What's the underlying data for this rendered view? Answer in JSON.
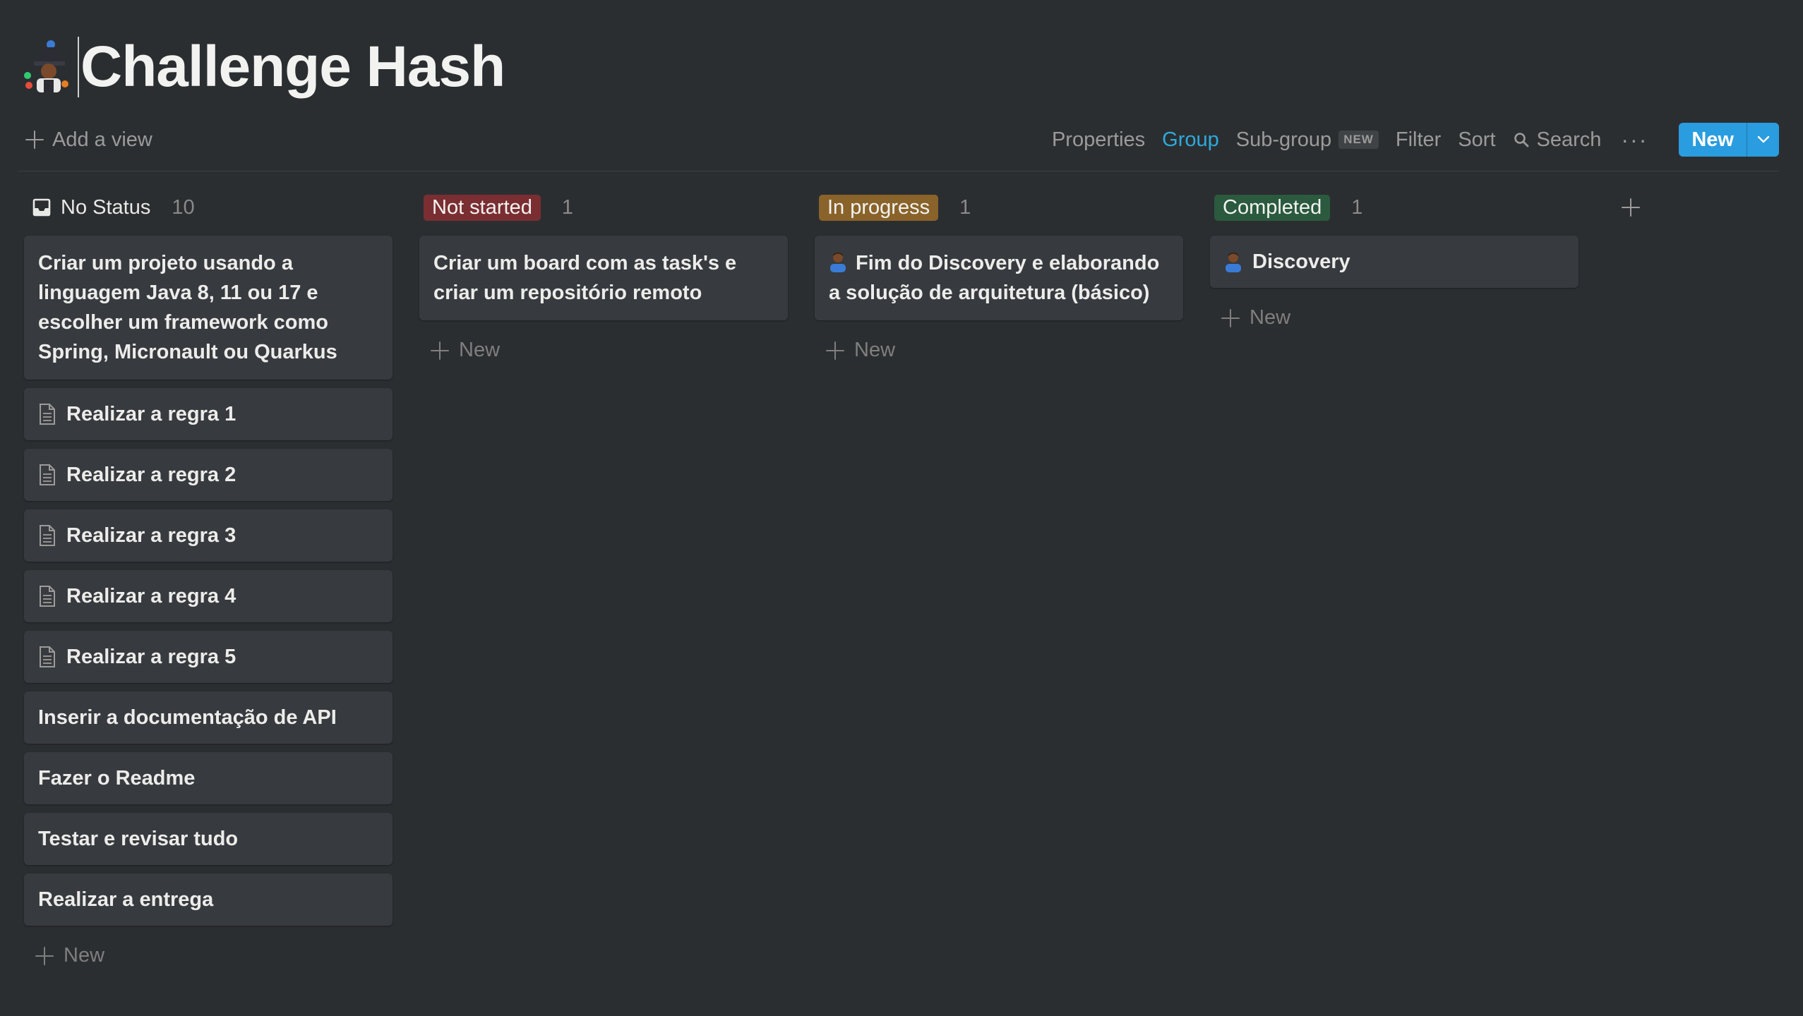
{
  "page": {
    "title": "Challenge Hash",
    "icon": "magician-emoji-icon"
  },
  "toolbar": {
    "add_view": "Add a view",
    "properties": "Properties",
    "group": "Group",
    "subgroup": "Sub-group",
    "subgroup_badge": "NEW",
    "filter": "Filter",
    "sort": "Sort",
    "search": "Search",
    "more": "···",
    "new_button": "New"
  },
  "colors": {
    "accent": "#2eaadc",
    "not_started": "#7a2e32",
    "in_progress": "#89632a",
    "completed": "#2b5a3e"
  },
  "columns": [
    {
      "title": "No Status",
      "count": "10",
      "cards": [
        {
          "text": "Criar um projeto usando a linguagem Java 8, 11 ou 17 e escolher um framework como Spring, Micronault ou Quarkus",
          "icon": ""
        },
        {
          "text": "Realizar a regra 1",
          "icon": "document-icon"
        },
        {
          "text": "Realizar a regra 2",
          "icon": "document-icon"
        },
        {
          "text": "Realizar a regra 3",
          "icon": "document-icon"
        },
        {
          "text": "Realizar a regra 4",
          "icon": "document-icon"
        },
        {
          "text": "Realizar a regra 5",
          "icon": "document-icon"
        },
        {
          "text": "Inserir a documentação de API",
          "icon": ""
        },
        {
          "text": "Fazer o Readme",
          "icon": ""
        },
        {
          "text": "Testar e revisar tudo",
          "icon": ""
        },
        {
          "text": "Realizar a entrega",
          "icon": ""
        }
      ],
      "new_label": "New"
    },
    {
      "title": "Not started",
      "count": "1",
      "cards": [
        {
          "text": "Criar um board com as task's e criar um repositório remoto",
          "icon": ""
        }
      ],
      "new_label": "New"
    },
    {
      "title": "In progress",
      "count": "1",
      "cards": [
        {
          "text": "Fim do Discovery e elaborando a solução de arquitetura (básico)",
          "icon": "person-emoji-icon"
        }
      ],
      "new_label": "New"
    },
    {
      "title": "Completed",
      "count": "1",
      "cards": [
        {
          "text": "Discovery",
          "icon": "person-emoji-icon"
        }
      ],
      "new_label": "New"
    }
  ]
}
